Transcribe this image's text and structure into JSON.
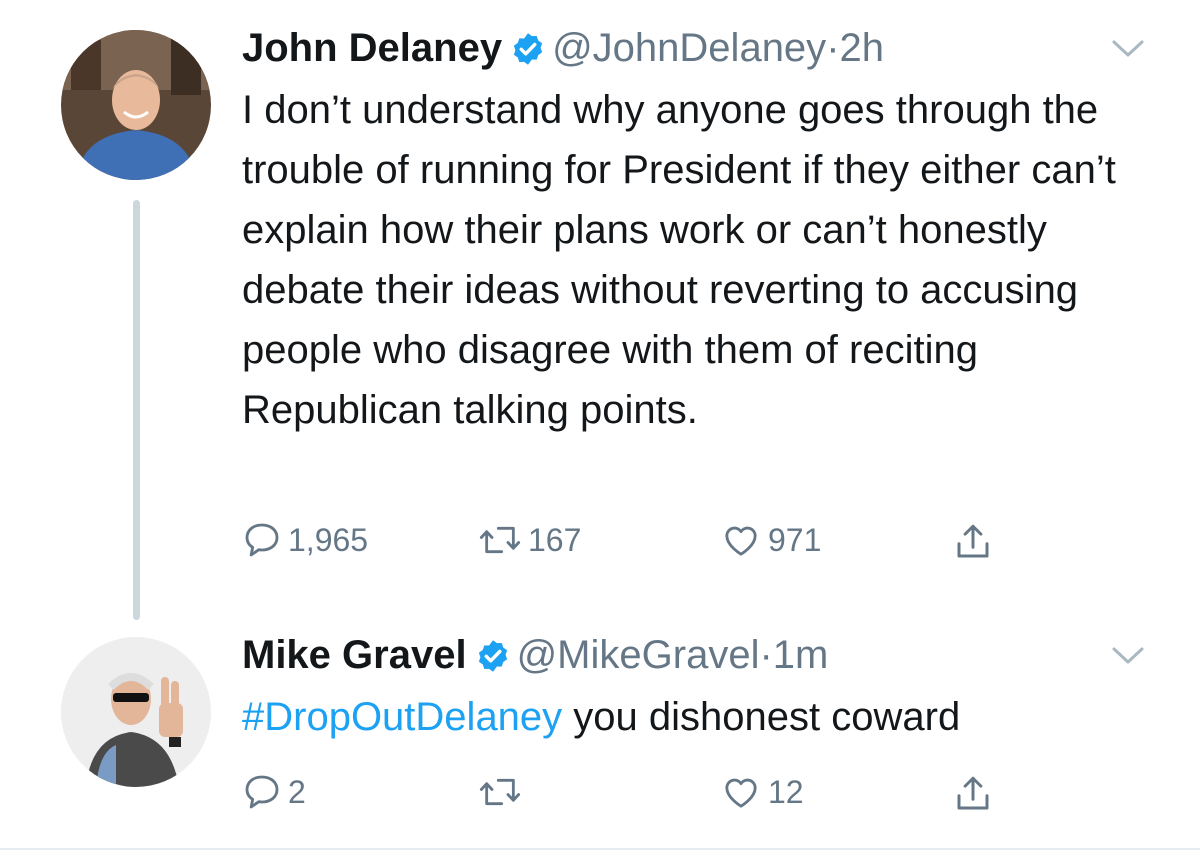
{
  "tweets": [
    {
      "author": "John Delaney",
      "handle": "@JohnDelaney",
      "dot": "·",
      "time": "2h",
      "text": "I don’t understand why anyone goes through the trouble of running for President if they either can’t explain how their plans work or can’t honestly debate their ideas without reverting to accusing people who disagree with them of reciting Republican talking points.",
      "replies": "1,965",
      "retweets": "167",
      "likes": "971",
      "verified": true
    },
    {
      "author": "Mike Gravel",
      "handle": "@MikeGravel",
      "dot": "·",
      "time": "1m",
      "hashtag": "#DropOutDelaney",
      "text": " you dishonest coward",
      "replies": "2",
      "retweets": "",
      "likes": "12",
      "verified": true
    }
  ],
  "colors": {
    "accent": "#1da1f2",
    "secondary_text": "#657786",
    "thread_line": "#ccd6dd"
  },
  "icons": [
    "reply-icon",
    "retweet-icon",
    "like-icon",
    "share-icon",
    "verified-badge-icon",
    "chevron-down-icon"
  ]
}
